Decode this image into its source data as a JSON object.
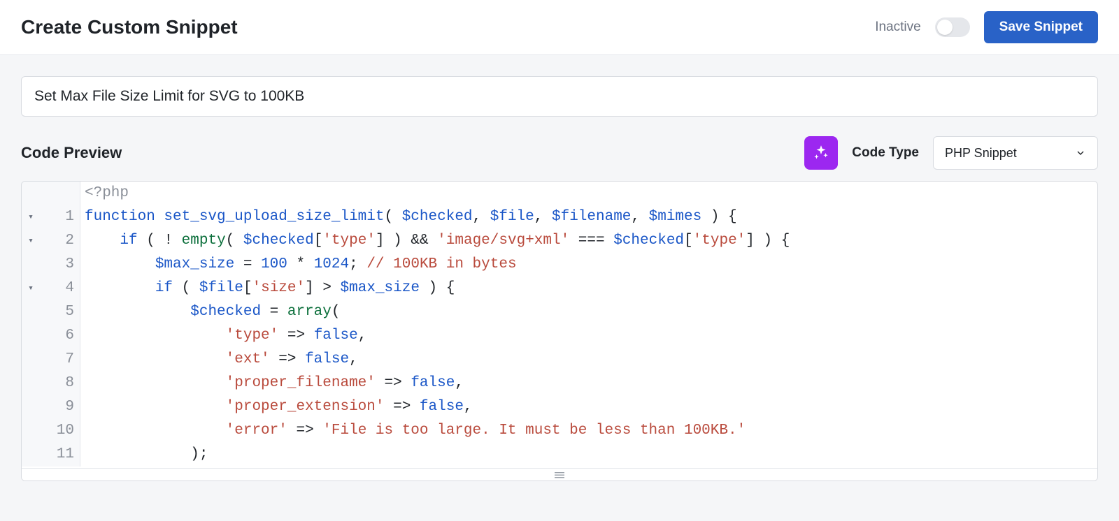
{
  "header": {
    "title": "Create Custom Snippet",
    "status_label": "Inactive",
    "save_button": "Save Snippet"
  },
  "snippet_title": {
    "value": "Set Max File Size Limit for SVG to 100KB"
  },
  "section": {
    "title": "Code Preview",
    "code_type_label": "Code Type",
    "code_type_value": "PHP Snippet"
  },
  "icons": {
    "ai": "sparkle-icon",
    "chevron": "chevron-down-icon",
    "resize": "drag-handle-icon"
  },
  "code": {
    "php_open": "<?php",
    "lines": [
      {
        "num": "1",
        "fold": true,
        "tokens": [
          {
            "t": "function ",
            "c": "kw"
          },
          {
            "t": "set_svg_upload_size_limit",
            "c": "kw"
          },
          {
            "t": "( ",
            "c": "plain"
          },
          {
            "t": "$checked",
            "c": "var"
          },
          {
            "t": ", ",
            "c": "plain"
          },
          {
            "t": "$file",
            "c": "var"
          },
          {
            "t": ", ",
            "c": "plain"
          },
          {
            "t": "$filename",
            "c": "var"
          },
          {
            "t": ", ",
            "c": "plain"
          },
          {
            "t": "$mimes",
            "c": "var"
          },
          {
            "t": " ) {",
            "c": "plain"
          }
        ]
      },
      {
        "num": "2",
        "fold": true,
        "indent": 1,
        "tokens": [
          {
            "t": "if",
            "c": "kw"
          },
          {
            "t": " ( ! ",
            "c": "plain"
          },
          {
            "t": "empty",
            "c": "fn"
          },
          {
            "t": "( ",
            "c": "plain"
          },
          {
            "t": "$checked",
            "c": "var"
          },
          {
            "t": "[",
            "c": "plain"
          },
          {
            "t": "'type'",
            "c": "str"
          },
          {
            "t": "] ) && ",
            "c": "plain"
          },
          {
            "t": "'image/svg+xml'",
            "c": "str"
          },
          {
            "t": " === ",
            "c": "plain"
          },
          {
            "t": "$checked",
            "c": "var"
          },
          {
            "t": "[",
            "c": "plain"
          },
          {
            "t": "'type'",
            "c": "str"
          },
          {
            "t": "] ) {",
            "c": "plain"
          }
        ]
      },
      {
        "num": "3",
        "indent": 2,
        "tokens": [
          {
            "t": "$max_size",
            "c": "var"
          },
          {
            "t": " = ",
            "c": "plain"
          },
          {
            "t": "100",
            "c": "num"
          },
          {
            "t": " * ",
            "c": "plain"
          },
          {
            "t": "1024",
            "c": "num"
          },
          {
            "t": "; ",
            "c": "plain"
          },
          {
            "t": "// 100KB in bytes",
            "c": "cmt"
          }
        ]
      },
      {
        "num": "4",
        "fold": true,
        "indent": 2,
        "tokens": [
          {
            "t": "if",
            "c": "kw"
          },
          {
            "t": " ( ",
            "c": "plain"
          },
          {
            "t": "$file",
            "c": "var"
          },
          {
            "t": "[",
            "c": "plain"
          },
          {
            "t": "'size'",
            "c": "str"
          },
          {
            "t": "] > ",
            "c": "plain"
          },
          {
            "t": "$max_size",
            "c": "var"
          },
          {
            "t": " ) {",
            "c": "plain"
          }
        ]
      },
      {
        "num": "5",
        "indent": 3,
        "tokens": [
          {
            "t": "$checked",
            "c": "var"
          },
          {
            "t": " = ",
            "c": "plain"
          },
          {
            "t": "array",
            "c": "fn"
          },
          {
            "t": "(",
            "c": "plain"
          }
        ]
      },
      {
        "num": "6",
        "indent": 4,
        "tokens": [
          {
            "t": "'type'",
            "c": "str"
          },
          {
            "t": " => ",
            "c": "plain"
          },
          {
            "t": "false",
            "c": "bool"
          },
          {
            "t": ",",
            "c": "plain"
          }
        ]
      },
      {
        "num": "7",
        "indent": 4,
        "tokens": [
          {
            "t": "'ext'",
            "c": "str"
          },
          {
            "t": " => ",
            "c": "plain"
          },
          {
            "t": "false",
            "c": "bool"
          },
          {
            "t": ",",
            "c": "plain"
          }
        ]
      },
      {
        "num": "8",
        "indent": 4,
        "tokens": [
          {
            "t": "'proper_filename'",
            "c": "str"
          },
          {
            "t": " => ",
            "c": "plain"
          },
          {
            "t": "false",
            "c": "bool"
          },
          {
            "t": ",",
            "c": "plain"
          }
        ]
      },
      {
        "num": "9",
        "indent": 4,
        "tokens": [
          {
            "t": "'proper_extension'",
            "c": "str"
          },
          {
            "t": " => ",
            "c": "plain"
          },
          {
            "t": "false",
            "c": "bool"
          },
          {
            "t": ",",
            "c": "plain"
          }
        ]
      },
      {
        "num": "10",
        "indent": 4,
        "tokens": [
          {
            "t": "'error'",
            "c": "str"
          },
          {
            "t": " => ",
            "c": "plain"
          },
          {
            "t": "'File is too large. It must be less than 100KB.'",
            "c": "str"
          }
        ]
      },
      {
        "num": "11",
        "indent": 3,
        "tokens": [
          {
            "t": ");",
            "c": "plain"
          }
        ]
      }
    ]
  }
}
